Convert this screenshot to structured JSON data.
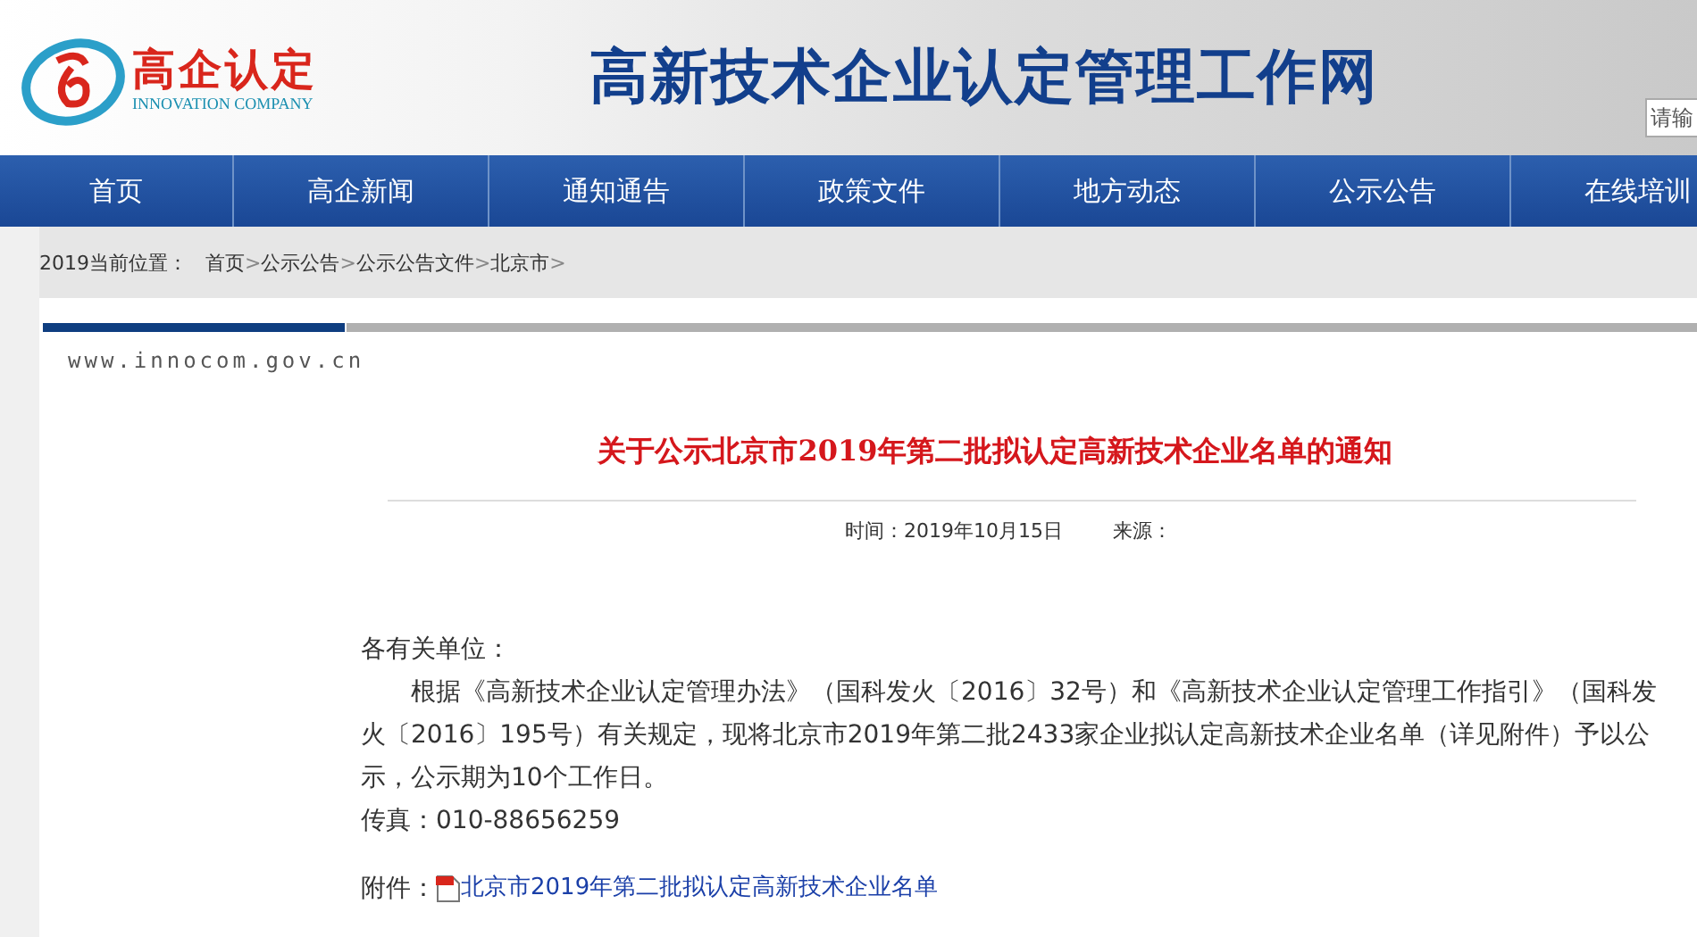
{
  "header": {
    "logo": {
      "name": "高企认定",
      "subtitle": "INNOVATION COMPANY"
    },
    "site_title": "高新技术企业认定管理工作网",
    "search": {
      "placeholder": "请输"
    }
  },
  "nav": {
    "items": [
      "首页",
      "高企新闻",
      "通知通告",
      "政策文件",
      "地方动态",
      "公示公告",
      "在线培训"
    ]
  },
  "breadcrumb": {
    "prefix": "2019当前位置：",
    "separator": ">",
    "items": [
      "首页",
      "公示公告",
      "公示公告文件",
      "北京市"
    ]
  },
  "article": {
    "site_url": "www.innocom.gov.cn",
    "title": "关于公示北京市2019年第二批拟认定高新技术企业名单的通知",
    "time_label": "时间：",
    "time": "2019年10月15日",
    "source_label": "来源：",
    "salutation": "各有关单位：",
    "body": "根据《高新技术企业认定管理办法》（国科发火〔2016〕32号）和《高新技术企业认定管理工作指引》（国科发火〔2016〕195号）有关规定，现将北京市2019年第二批2433家企业拟认定高新技术企业名单（详见附件）予以公示，公示期为10个工作日。",
    "fax": "传真：010-88656259",
    "attachment_label": "附件：",
    "attachment": "北京市2019年第二批拟认定高新技术企业名单"
  }
}
